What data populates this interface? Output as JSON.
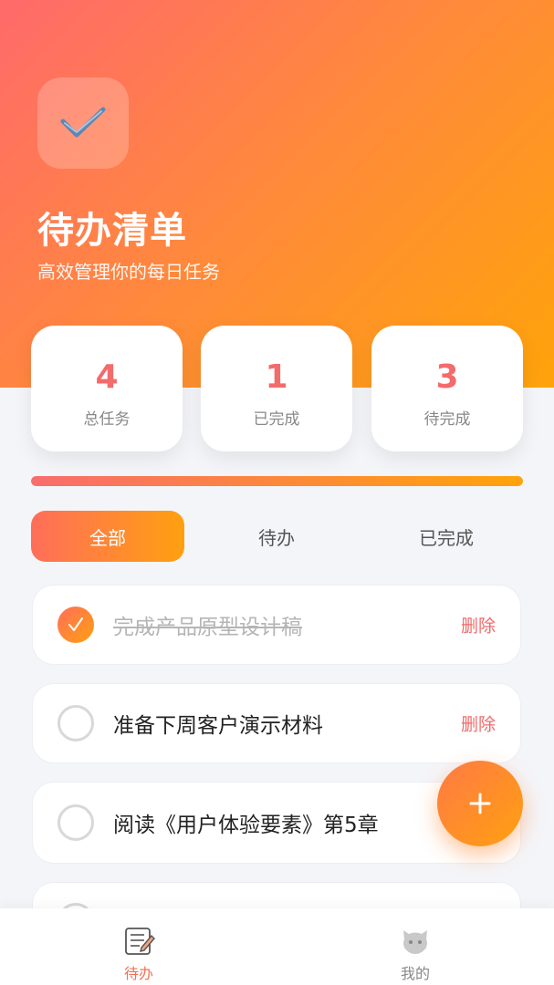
{
  "header": {
    "title": "待办清单",
    "subtitle": "高效管理你的每日任务",
    "app_icon": "checkmark-icon"
  },
  "stats": [
    {
      "value": "4",
      "label": "总任务"
    },
    {
      "value": "1",
      "label": "已完成"
    },
    {
      "value": "3",
      "label": "待完成"
    }
  ],
  "progress": {
    "fraction": 1.0
  },
  "filter_tabs": [
    {
      "label": "全部",
      "active": true
    },
    {
      "label": "待办",
      "active": false
    },
    {
      "label": "已完成",
      "active": false
    }
  ],
  "todos": [
    {
      "text": "完成产品原型设计稿",
      "done": true,
      "delete_label": "删除"
    },
    {
      "text": "准备下周客户演示材料",
      "done": false,
      "delete_label": "删除"
    },
    {
      "text": "阅读《用户体验要素》第5章",
      "done": false,
      "delete_label": ""
    },
    {
      "text": "",
      "done": false,
      "delete_label": ""
    }
  ],
  "fab": {
    "label": "+",
    "icon": "plus-icon"
  },
  "tabbar": [
    {
      "label": "待办",
      "icon": "notepad-icon",
      "active": true
    },
    {
      "label": "我的",
      "icon": "profile-icon",
      "active": false
    }
  ],
  "colors": {
    "accent_start": "#ff6a6a",
    "accent_end": "#ffa30a",
    "stat_value": "#f36b6b",
    "delete": "#f06a6a",
    "tab_active": "#f27254"
  }
}
